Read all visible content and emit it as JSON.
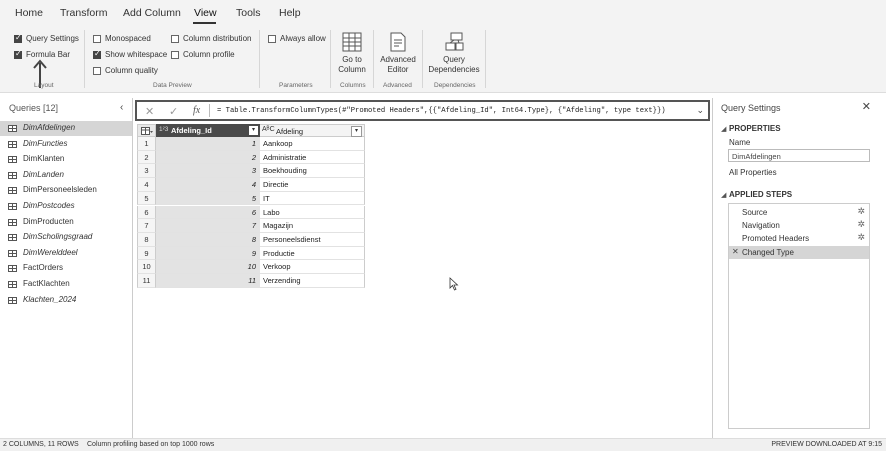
{
  "tabs": [
    "Home",
    "Transform",
    "Add Column",
    "View",
    "Tools",
    "Help"
  ],
  "ribbon": {
    "layout": {
      "group": "Layout",
      "query_settings": "Query Settings",
      "formula_bar": "Formula Bar"
    },
    "data_preview": {
      "group": "Data Preview",
      "monospaced": "Monospaced",
      "show_whitespace": "Show whitespace",
      "column_quality": "Column quality",
      "column_distribution": "Column distribution",
      "column_profile": "Column profile"
    },
    "parameters": {
      "group": "Parameters",
      "always_allow": "Always allow"
    },
    "columns": {
      "group": "Columns",
      "go_to_column_l1": "Go to",
      "go_to_column_l2": "Column"
    },
    "advanced": {
      "group": "Advanced",
      "advanced_editor_l1": "Advanced",
      "advanced_editor_l2": "Editor"
    },
    "dependencies": {
      "group": "Dependencies",
      "query_dependencies_l1": "Query",
      "query_dependencies_l2": "Dependencies"
    }
  },
  "queries": {
    "title": "Queries [12]",
    "items": [
      {
        "label": "DimAfdelingen",
        "italic": true,
        "selected": true
      },
      {
        "label": "DimFuncties",
        "italic": true
      },
      {
        "label": "DimKlanten",
        "italic": false
      },
      {
        "label": "DimLanden",
        "italic": true
      },
      {
        "label": "DimPersoneelsleden",
        "italic": false
      },
      {
        "label": "DimPostcodes",
        "italic": true
      },
      {
        "label": "DimProducten",
        "italic": false
      },
      {
        "label": "DimScholingsgraad",
        "italic": true
      },
      {
        "label": "DimWerelddeel",
        "italic": true
      },
      {
        "label": "FactOrders",
        "italic": false
      },
      {
        "label": "FactKlachten",
        "italic": false
      },
      {
        "label": "Klachten_2024",
        "italic": true
      }
    ]
  },
  "formula": {
    "cancel_icon": "✕",
    "commit_icon": "✓",
    "fx": "fx",
    "text": "= Table.TransformColumnTypes(#\"Promoted Headers\",{{\"Afdeling_Id\", Int64.Type}, {\"Afdeling\", type text}})"
  },
  "table": {
    "columns": [
      {
        "name": "Afdeling_Id",
        "type_icon": "1²3"
      },
      {
        "name": "Afdeling",
        "type_icon": "AᴮC"
      }
    ],
    "rows": [
      {
        "n": "1",
        "id": "1",
        "name": "Aankoop"
      },
      {
        "n": "2",
        "id": "2",
        "name": "Administratie"
      },
      {
        "n": "3",
        "id": "3",
        "name": "Boekhouding"
      },
      {
        "n": "4",
        "id": "4",
        "name": "Directie"
      },
      {
        "n": "5",
        "id": "5",
        "name": "IT"
      },
      {
        "n": "6",
        "id": "6",
        "name": "Labo"
      },
      {
        "n": "7",
        "id": "7",
        "name": "Magazijn"
      },
      {
        "n": "8",
        "id": "8",
        "name": "Personeelsdienst"
      },
      {
        "n": "9",
        "id": "9",
        "name": "Productie"
      },
      {
        "n": "10",
        "id": "10",
        "name": "Verkoop"
      },
      {
        "n": "11",
        "id": "11",
        "name": "Verzending"
      }
    ]
  },
  "settings": {
    "title": "Query Settings",
    "properties": "PROPERTIES",
    "name_label": "Name",
    "name_value": "DimAfdelingen",
    "all_properties": "All Properties",
    "applied_steps": "APPLIED STEPS",
    "steps": [
      "Source",
      "Navigation",
      "Promoted Headers",
      "Changed Type"
    ]
  },
  "status": {
    "left": "2 COLUMNS, 11 ROWS",
    "profiling": "Column profiling based on top 1000 rows",
    "right": "PREVIEW DOWNLOADED AT 9:15"
  }
}
